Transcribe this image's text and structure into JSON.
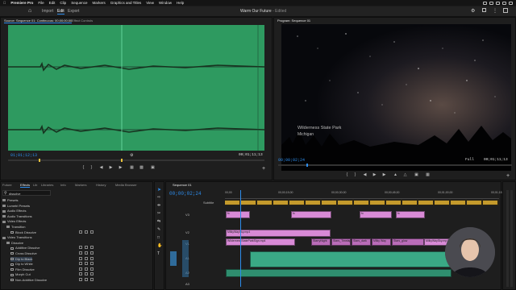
{
  "menubar": {
    "items": [
      "Premiere Pro",
      "File",
      "Edit",
      "Clip",
      "Sequence",
      "Markers",
      "Graphics and Titles",
      "View",
      "Window",
      "Help"
    ]
  },
  "header": {
    "tabs": [
      "Import",
      "Edit",
      "Export"
    ],
    "title": "Warm Our Future",
    "title_status": "- Edited"
  },
  "source_panel": {
    "tab_label": "Source: Sequence 01: Continuous: 00;00;00;00",
    "tab2_label": "Effect Controls",
    "timecode_in": "01;01;12;13",
    "timecode_duration": "00;01;11;13"
  },
  "program_panel": {
    "tab_label": "Program: Sequence 01",
    "overlay_line1": "Wilderness State Park",
    "overlay_line2": "Michigan",
    "timecode": "00;00;02;24",
    "fit_label": "Full",
    "duration": "00;01;11;13"
  },
  "project_panel": {
    "tabs": [
      "Future",
      "Effects",
      "Lib",
      "Libraries",
      "Info",
      "Markers",
      "History",
      "Media Browser"
    ],
    "search_placeholder": "dissolve",
    "tree": [
      {
        "label": "Presets",
        "type": "folder",
        "indent": 0
      },
      {
        "label": "Lumetri Presets",
        "type": "folder",
        "indent": 0
      },
      {
        "label": "Audio Effects",
        "type": "folder",
        "indent": 0
      },
      {
        "label": "Audio Transitions",
        "type": "folder",
        "indent": 0
      },
      {
        "label": "Video Effects",
        "type": "folder",
        "indent": 0
      },
      {
        "label": "Transition",
        "type": "folder",
        "indent": 1
      },
      {
        "label": "Block Dissolve",
        "type": "fx",
        "indent": 2
      },
      {
        "label": "Video Transitions",
        "type": "folder",
        "indent": 0
      },
      {
        "label": "Dissolve",
        "type": "folder",
        "indent": 1
      },
      {
        "label": "Additive Dissolve",
        "type": "fx",
        "indent": 2
      },
      {
        "label": "Cross Dissolve",
        "type": "fx",
        "indent": 2
      },
      {
        "label": "Dip to Black",
        "type": "fx",
        "indent": 2
      },
      {
        "label": "Dip to White",
        "type": "fx",
        "indent": 2
      },
      {
        "label": "Film Dissolve",
        "type": "fx",
        "indent": 2
      },
      {
        "label": "Morph Cut",
        "type": "fx",
        "indent": 2
      },
      {
        "label": "Non-Additive Dissolve",
        "type": "fx",
        "indent": 2
      }
    ]
  },
  "timeline": {
    "tab_label": "Sequence 01",
    "timecode": "00;00;02;24",
    "ruler_labels": [
      "00;00",
      "00;00;15;00",
      "00;00;30;00",
      "00;00;45;00",
      "00;01;00;00",
      "00;01;15;00"
    ],
    "subtitle_track": "Subtitle",
    "tracks": [
      "V3",
      "V2",
      "V1",
      "A1",
      "A2",
      "A3"
    ],
    "clips": {
      "v3": [
        "fx",
        "fx",
        "fx",
        "fx"
      ],
      "v2": [
        "MilkyWaySky.mp4"
      ],
      "v1": [
        "WildernessStateParkSign.mp4",
        "StarryNight",
        "Stars_Timelapse",
        "Stars_dark",
        "Milky Way",
        "Stars_glow",
        "MilkyWaySky.mp4"
      ]
    }
  },
  "colors": {
    "accent": "#2d8ceb",
    "source_bg": "#2e9a60",
    "clip_pink": "#d88ad6",
    "audio_green": "#3aa985"
  },
  "icons": [
    "apple-icon",
    "home-icon",
    "search-icon",
    "settings-icon",
    "fullscreen-icon",
    "wrench-icon",
    "play-icon",
    "step-back-icon",
    "step-forward-icon",
    "mark-in-icon",
    "mark-out-icon",
    "export-frame-icon",
    "camera-icon"
  ]
}
